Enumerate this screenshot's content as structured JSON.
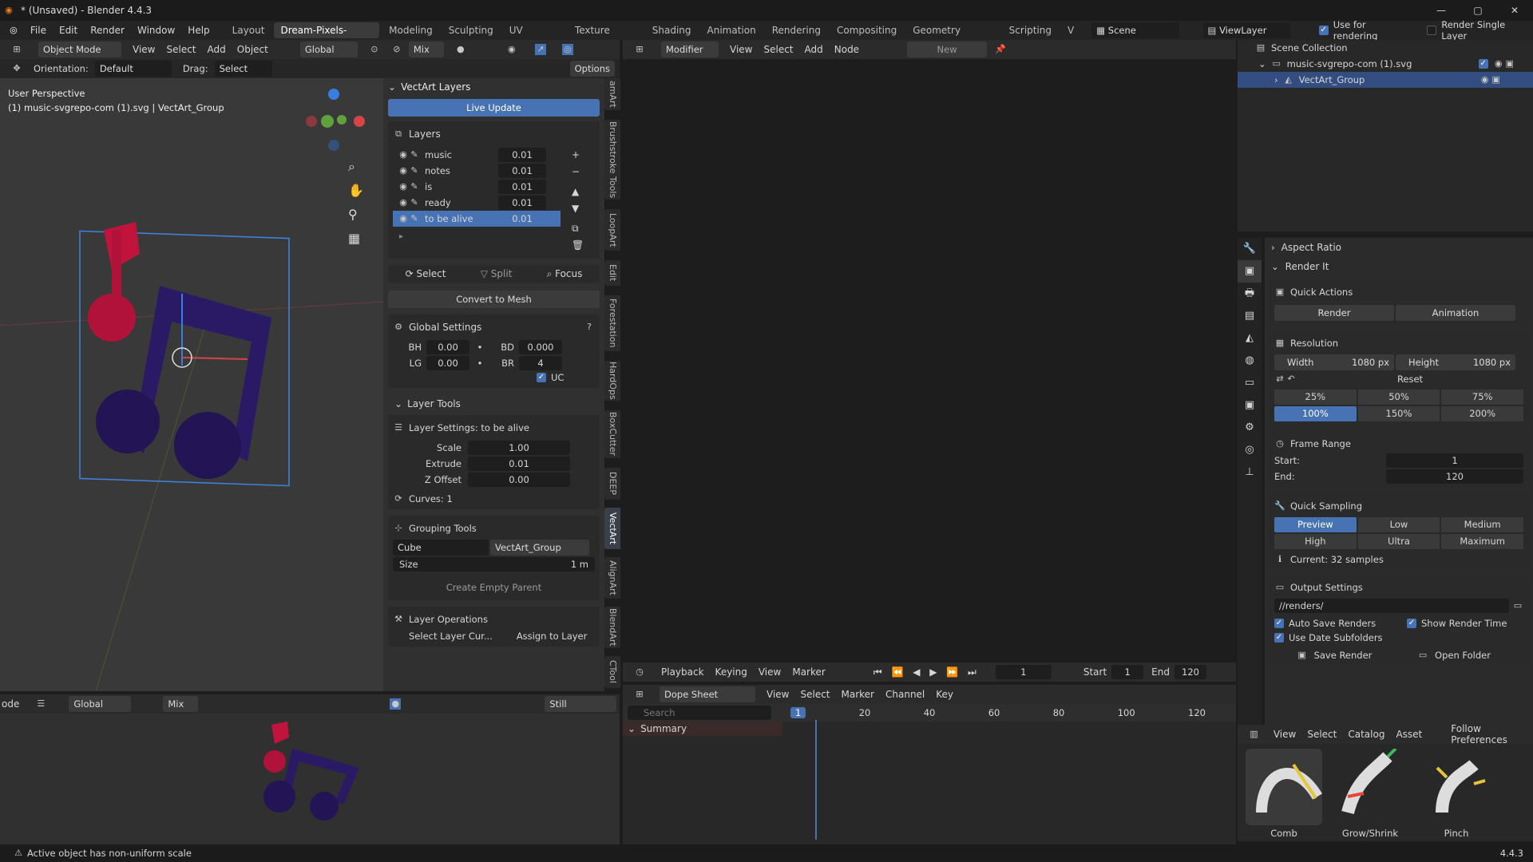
{
  "titlebar": {
    "title": "* (Unsaved) - Blender 4.4.3"
  },
  "menu": [
    "File",
    "Edit",
    "Render",
    "Window",
    "Help"
  ],
  "workspaces": [
    {
      "label": "Layout",
      "active": false
    },
    {
      "label": "Dream-Pixels-Forge",
      "active": true
    },
    {
      "label": "Modeling",
      "active": false
    },
    {
      "label": "Sculpting",
      "active": false
    },
    {
      "label": "UV Editing",
      "active": false
    },
    {
      "label": "Texture Paint",
      "active": false
    },
    {
      "label": "Shading",
      "active": false
    },
    {
      "label": "Animation",
      "active": false
    },
    {
      "label": "Rendering",
      "active": false
    },
    {
      "label": "Compositing",
      "active": false
    },
    {
      "label": "Geometry Nodes",
      "active": false
    },
    {
      "label": "Scripting",
      "active": false
    },
    {
      "label": "V",
      "active": false
    }
  ],
  "top_right": {
    "scene": "Scene",
    "view_layer": "ViewLayer",
    "use_for_rendering": "Use for rendering",
    "render_single_layer": "Render Single Layer"
  },
  "viewport": {
    "mode": "Object Mode",
    "menus": [
      "View",
      "Select",
      "Add",
      "Object"
    ],
    "transform": "Global",
    "mix": "Mix",
    "orientation_label": "Orientation:",
    "orientation": "Default",
    "drag_label": "Drag:",
    "drag": "Select Box",
    "options": "Options",
    "perspective": "User Perspective",
    "object_info": "(1) music-svgrepo-com (1).svg | VectArt_Group"
  },
  "node_editor": {
    "editor": "Modifier",
    "menus": [
      "View",
      "Select",
      "Add",
      "Node"
    ],
    "new": "New"
  },
  "vectart": {
    "title": "VectArt Layers",
    "live_update": "Live Update",
    "layers_label": "Layers",
    "layers": [
      {
        "name": "music",
        "value": "0.01",
        "selected": false
      },
      {
        "name": "notes",
        "value": "0.01",
        "selected": false
      },
      {
        "name": "is",
        "value": "0.01",
        "selected": false
      },
      {
        "name": "ready",
        "value": "0.01",
        "selected": false
      },
      {
        "name": "to be alive",
        "value": "0.01",
        "selected": true
      }
    ],
    "select": "Select",
    "split": "Split",
    "focus": "Focus",
    "convert": "Convert to Mesh",
    "global_settings": "Global Settings",
    "gs": {
      "bh_label": "BH",
      "bh": "0.00",
      "bd_label": "BD",
      "bd": "0.000",
      "lg_label": "LG",
      "lg": "0.00",
      "br_label": "BR",
      "br": "4",
      "uc": "UC"
    },
    "layer_tools": "Layer Tools",
    "layer_settings": "Layer Settings: to be alive",
    "scale_label": "Scale",
    "scale": "1.00",
    "extrude_label": "Extrude",
    "extrude": "0.01",
    "zoffset_label": "Z Offset",
    "zoffset": "0.00",
    "curves": "Curves: 1",
    "grouping_tools": "Grouping Tools",
    "group_shape": "Cube",
    "group_name": "VectArt_Group",
    "size_label": "Size",
    "size": "1 m",
    "create_empty": "Create Empty Parent",
    "layer_ops": "Layer Operations",
    "select_layer_cur": "Select Layer Cur...",
    "assign_to_layer": "Assign to Layer"
  },
  "side_tabs": [
    {
      "label": "amArt",
      "active": false
    },
    {
      "label": "Brushstroke Tools",
      "active": false
    },
    {
      "label": "LoopArt",
      "active": false
    },
    {
      "label": "Edit",
      "active": false
    },
    {
      "label": "Forestation",
      "active": false
    },
    {
      "label": "HardOps",
      "active": false
    },
    {
      "label": "BoxCutter",
      "active": false
    },
    {
      "label": "DEEP",
      "active": false
    },
    {
      "label": "VectArt",
      "active": true
    },
    {
      "label": "AlignArt",
      "active": false
    },
    {
      "label": "BlendArt",
      "active": false
    },
    {
      "label": "CTool",
      "active": false
    }
  ],
  "outliner": {
    "collection": "Scene Collection",
    "items": [
      {
        "name": "music-svgrepo-com (1).svg",
        "selected": false
      },
      {
        "name": "VectArt_Group",
        "selected": true
      }
    ]
  },
  "props": {
    "aspect_ratio": "Aspect Ratio",
    "render_it": "Render It",
    "quick_actions": "Quick Actions",
    "render": "Render",
    "animation": "Animation",
    "resolution": "Resolution",
    "width_label": "Width",
    "width": "1080 px",
    "height_label": "Height",
    "height": "1080 px",
    "reset": "Reset",
    "percents": [
      {
        "label": "25%",
        "on": false
      },
      {
        "label": "50%",
        "on": false
      },
      {
        "label": "75%",
        "on": false
      },
      {
        "label": "100%",
        "on": true
      },
      {
        "label": "150%",
        "on": false
      },
      {
        "label": "200%",
        "on": false
      }
    ],
    "frame_range": "Frame Range",
    "start_label": "Start:",
    "start": "1",
    "end_label": "End:",
    "end": "120",
    "quick_sampling": "Quick Sampling",
    "samples": [
      {
        "label": "Preview",
        "on": true
      },
      {
        "label": "Low",
        "on": false
      },
      {
        "label": "Medium",
        "on": false
      },
      {
        "label": "High",
        "on": false
      },
      {
        "label": "Ultra",
        "on": false
      },
      {
        "label": "Maximum",
        "on": false
      }
    ],
    "current": "Current: 32 samples",
    "output_settings": "Output Settings",
    "output_path": "//renders/",
    "auto_save": "Auto Save Renders",
    "show_time": "Show Render Time",
    "date_sub": "Use Date Subfolders",
    "save_render": "Save Render",
    "open_folder": "Open Folder"
  },
  "timeline": {
    "menus": [
      "Playback",
      "Keying",
      "View",
      "Marker"
    ],
    "frame": "1",
    "start_label": "Start",
    "start": "1",
    "end_label": "End",
    "end": "120"
  },
  "dopesheet": {
    "mode": "Dope Sheet",
    "menus": [
      "View",
      "Select",
      "Marker",
      "Channel",
      "Key"
    ],
    "search": "Search",
    "summary": "Summary",
    "ticks": [
      "1",
      "20",
      "40",
      "60",
      "80",
      "100",
      "120"
    ]
  },
  "bottom_viewport": {
    "transform": "Global",
    "mix": "Mix",
    "shading": "Still",
    "mode": "ode"
  },
  "asset_browser": {
    "menus": [
      "View",
      "Select",
      "Catalog",
      "Asset"
    ],
    "follow": "Follow Preferences",
    "brushes": [
      "Comb",
      "Grow/Shrink",
      "Pinch"
    ]
  },
  "status": {
    "message": "Active object has non-uniform scale",
    "version": "4.4.3"
  }
}
